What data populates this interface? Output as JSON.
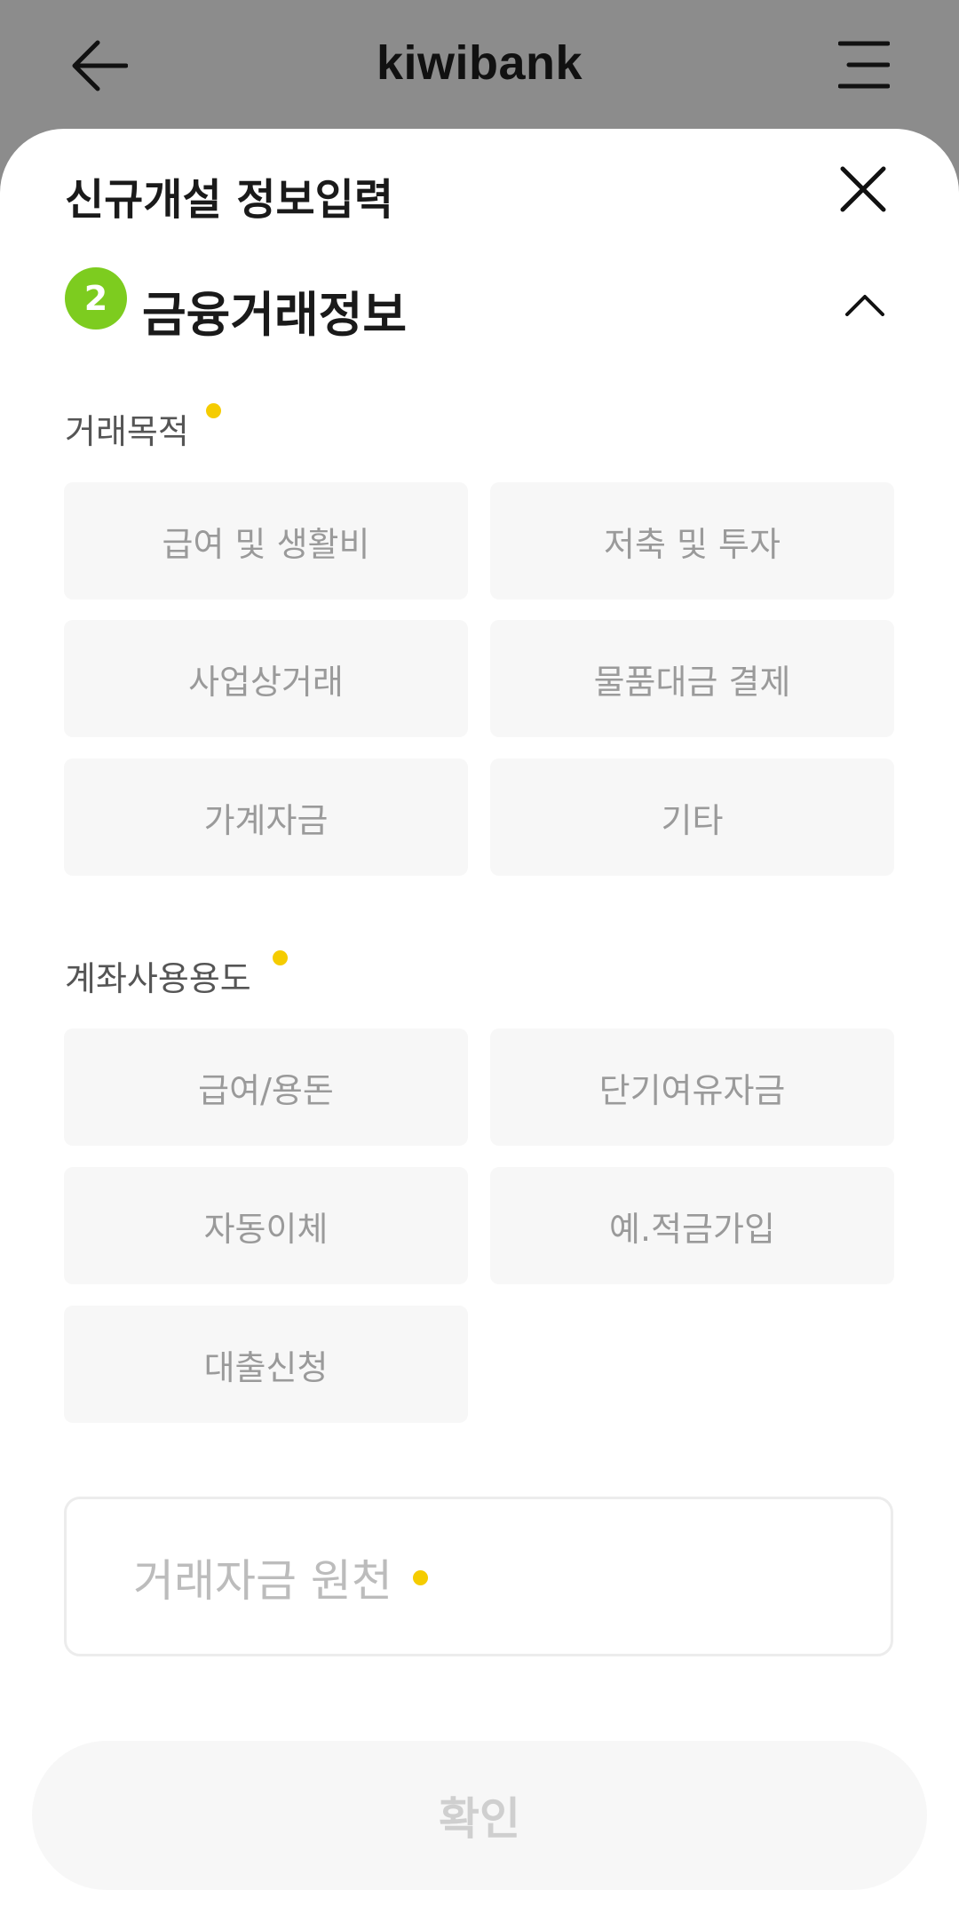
{
  "header": {
    "title": "kiwibank",
    "back_icon": "arrow-left-icon",
    "menu_icon": "hamburger-menu-icon"
  },
  "sheet": {
    "title": "신규개설 정보입력",
    "close_icon": "close-icon",
    "step": {
      "number": "2",
      "title": "금융거래정보",
      "badge_color": "#7dcc1f",
      "toggle_icon": "chevron-up-icon"
    },
    "purpose": {
      "label": "거래목적",
      "options": [
        "급여 및 생활비",
        "저축 및 투자",
        "사업상거래",
        "물품대금 결제",
        "가계자금",
        "기타"
      ]
    },
    "usage": {
      "label": "계좌사용용도",
      "options": [
        "급여/용돈",
        "단기여유자금",
        "자동이체",
        "예.적금가입",
        "대출신청"
      ]
    },
    "fund_source": {
      "placeholder": "거래자금 원천"
    },
    "confirm_label": "확인",
    "required_dot_color": "#f5cc00"
  }
}
